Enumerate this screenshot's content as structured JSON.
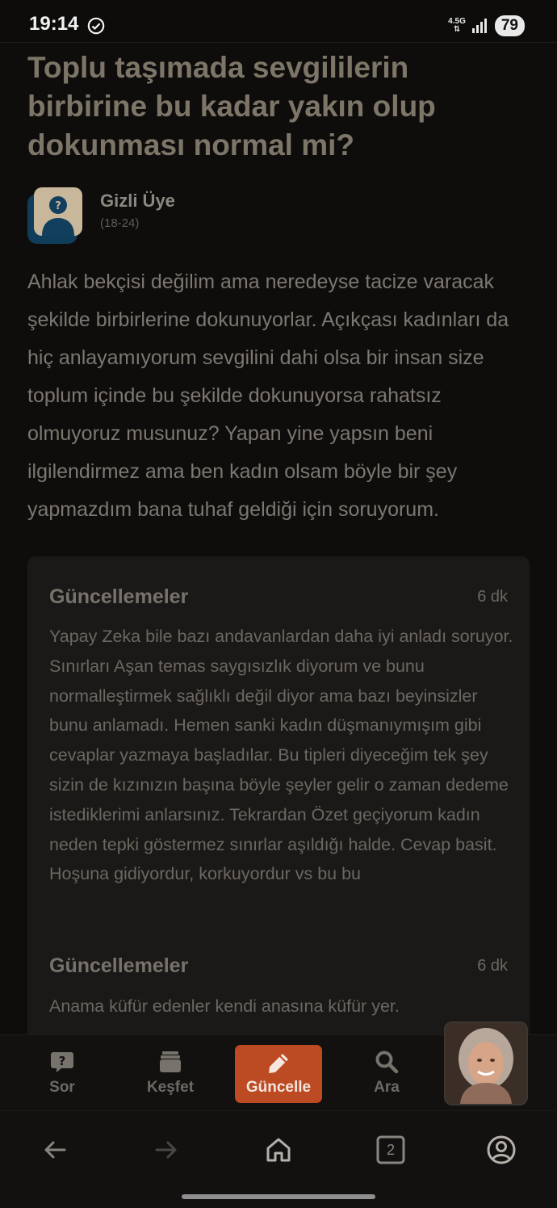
{
  "status_bar": {
    "time": "19:14",
    "network": "4.5G",
    "battery": "79"
  },
  "post": {
    "title": "Toplu taşımada sevgililerin birbirine bu kadar yakın olup dokunması normal mi?",
    "author_name": "Gizli Üye",
    "author_age": "(18-24)",
    "body": "Ahlak bekçisi değilim ama neredeyse tacize varacak şekilde birbirlerine dokunuyorlar. Açıkçası kadınları da hiç anlayamıyorum sevgilini dahi olsa bir insan size toplum içinde bu şekilde dokunuyorsa rahatsız olmuyoruz musunuz? Yapan yine yapsın beni ilgilendirmez ama ben kadın olsam böyle bir şey yapmazdım bana tuhaf geldiği için soruyorum."
  },
  "updates": [
    {
      "heading": "Güncellemeler",
      "time": "6 dk",
      "text": "Yapay Zeka bile bazı andavanlardan daha iyi anladı soruyor. Sınırları Aşan temas saygısızlık diyorum ve bunu normalleştirmek sağlıklı değil diyor ama bazı beyinsizler bunu anlamadı. Hemen sanki kadın düşmanıymışım gibi cevaplar yazmaya başladılar. Bu tipleri diyeceğim tek şey sizin de kızınızın başına böyle şeyler gelir o zaman dedeme istediklerimi anlarsınız. Tekrardan Özet geçiyorum kadın neden tepki göstermez sınırlar aşıldığı halde. Cevap basit. Hoşuna gidiyordur, korkuyordur vs bu bu"
    },
    {
      "heading": "Güncellemeler",
      "time": "6 dk",
      "text": "Anama küfür edenler kendi anasına küfür yer."
    }
  ],
  "app_nav": {
    "items": [
      {
        "label": "Sor",
        "icon": "question-bubble-icon"
      },
      {
        "label": "Keşfet",
        "icon": "cards-icon"
      },
      {
        "label": "Güncelle",
        "icon": "pencil-icon"
      },
      {
        "label": "Ara",
        "icon": "search-icon"
      }
    ],
    "active": "Güncelle"
  },
  "system_nav": {
    "tabs_count": "2"
  },
  "colors": {
    "background": "#0e0d0c",
    "accent": "#bc4a22",
    "card": "#1b1917"
  }
}
